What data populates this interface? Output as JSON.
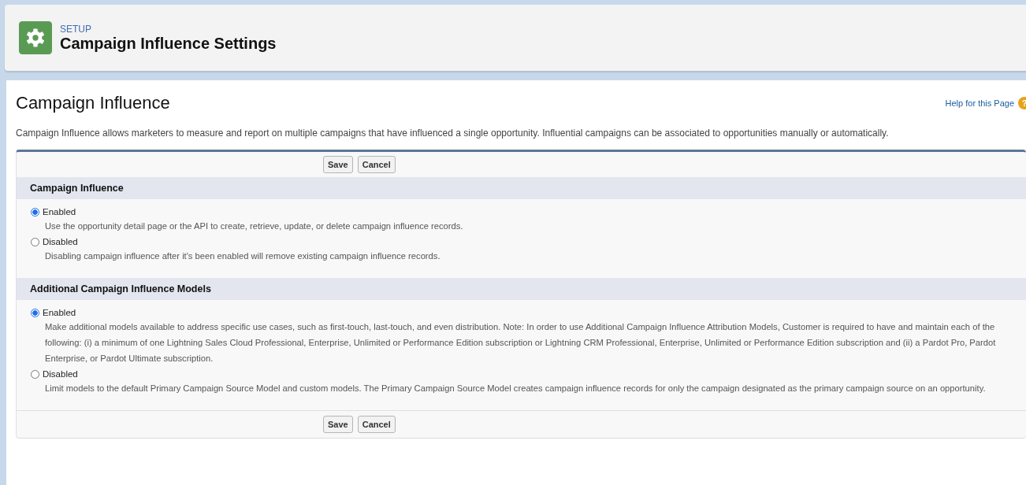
{
  "header": {
    "breadcrumb": "SETUP",
    "title": "Campaign Influence Settings"
  },
  "page": {
    "title": "Campaign Influence",
    "help_link": "Help for this Page",
    "help_icon": "?",
    "description": "Campaign Influence allows marketers to measure and report on multiple campaigns that have influenced a single opportunity. Influential campaigns can be associated to opportunities manually or automatically."
  },
  "top_buttons": [
    "Save",
    "Cancel"
  ],
  "sections": [
    {
      "title": "Campaign Influence",
      "options": [
        {
          "label": "Enabled",
          "selected": true,
          "help": "Use the opportunity detail page or the API to create, retrieve, update, or delete campaign influence records."
        },
        {
          "label": "Disabled",
          "selected": false,
          "help": "Disabling campaign influence after it's been enabled will remove existing campaign influence records."
        }
      ]
    },
    {
      "title": "Additional Campaign Influence Models",
      "options": [
        {
          "label": "Enabled",
          "selected": true,
          "help": "Make additional models available to address specific use cases, such as first-touch, last-touch, and even distribution. Note: In order to use Additional Campaign Influence Attribution Models, Customer is required to have and maintain each of the following: (i) a minimum of one Lightning Sales Cloud Professional, Enterprise, Unlimited or Performance Edition subscription or Lightning CRM Professional, Enterprise, Unlimited or Performance Edition subscription and (ii) a Pardot Pro, Pardot Enterprise, or Pardot Ultimate subscription."
        },
        {
          "label": "Disabled",
          "selected": false,
          "help": "Limit models to the default Primary Campaign Source Model and custom models. The Primary Campaign Source Model creates campaign influence records for only the campaign designated as the primary campaign source on an opportunity."
        }
      ]
    }
  ],
  "bottom_buttons": [
    "Save",
    "Cancel"
  ]
}
